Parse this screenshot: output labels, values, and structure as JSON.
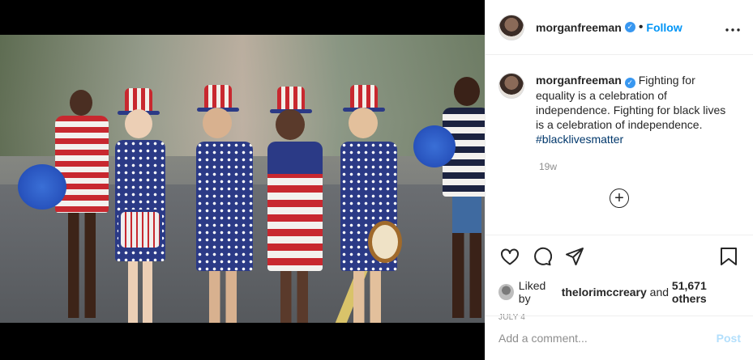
{
  "post": {
    "username": "morganfreeman",
    "follow_label": "Follow",
    "separator": "•",
    "more_icon": "more-horizontal-icon",
    "verified_icon": "verified-badge-icon"
  },
  "caption": {
    "username": "morganfreeman",
    "text": "Fighting for equality is a celebration of independence. Fighting for black lives is a celebration of independence.",
    "hashtag": "#blacklivesmatter",
    "time_ago": "19w"
  },
  "actions": {
    "like_icon": "heart-icon",
    "comment_icon": "comment-icon",
    "share_icon": "share-icon",
    "save_icon": "bookmark-icon",
    "load_more_icon": "plus-circle-icon"
  },
  "likes": {
    "prefix": "Liked by",
    "user": "thelorimccreary",
    "conjunction": "and",
    "others": "51,671 others"
  },
  "date": "JULY 4",
  "comment_box": {
    "placeholder": "Add a comment...",
    "post_label": "Post"
  },
  "colors": {
    "link_blue": "#0095f6",
    "verified_blue": "#3897f0",
    "hashtag_blue": "#00376b",
    "muted_gray": "#8e8e8e",
    "post_disabled": "#b2dffc"
  }
}
